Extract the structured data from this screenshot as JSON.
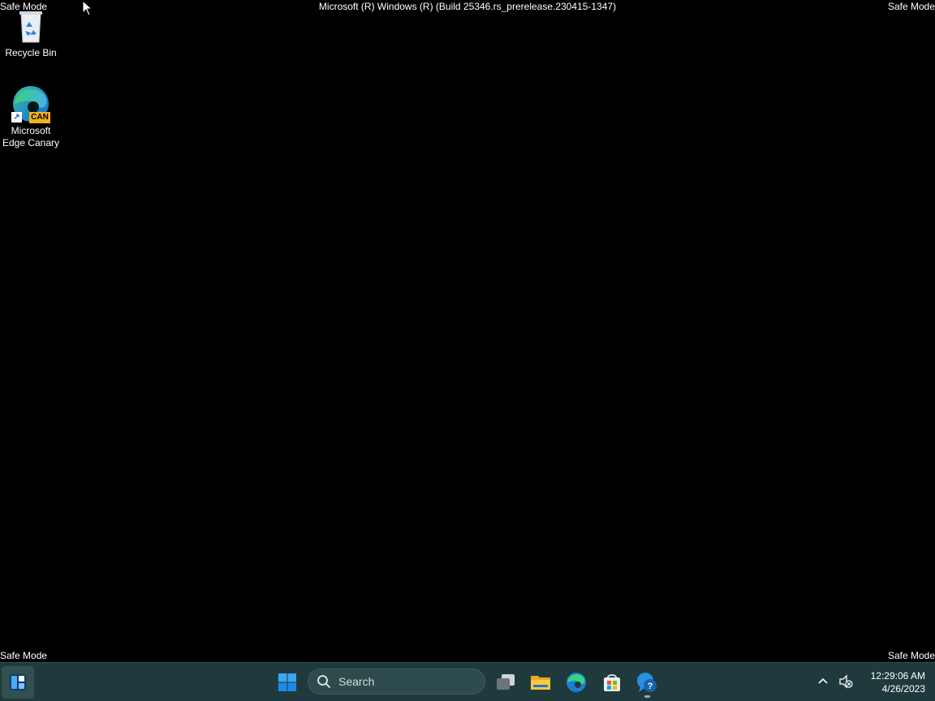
{
  "desktop": {
    "safe_mode_top_left": "Safe Mode",
    "safe_mode_top_right": "Safe Mode",
    "safe_mode_bottom_left": "Safe Mode",
    "safe_mode_bottom_right": "Safe Mode",
    "build_banner": "Microsoft (R) Windows (R) (Build 25346.rs_prerelease.230415-1347)",
    "icons": [
      {
        "label": "Recycle Bin",
        "icon": "recycle-bin-icon"
      },
      {
        "label_line1": "Microsoft",
        "label_line2": "Edge Canary",
        "badge": "CAN",
        "icon": "edge-canary-icon"
      }
    ]
  },
  "taskbar": {
    "search_placeholder": "Search",
    "apps": [
      {
        "name": "widgets",
        "icon": "widgets-icon"
      },
      {
        "name": "start",
        "icon": "windows-start-icon"
      },
      {
        "name": "task-view",
        "icon": "task-view-icon"
      },
      {
        "name": "file-explorer",
        "icon": "folder-icon"
      },
      {
        "name": "edge",
        "icon": "edge-icon"
      },
      {
        "name": "microsoft-store",
        "icon": "store-icon"
      },
      {
        "name": "get-help",
        "icon": "help-icon"
      }
    ],
    "clock": {
      "time": "12:29:06 AM",
      "date": "4/26/2023"
    }
  },
  "colors": {
    "desktop_background": "#000000",
    "taskbar_background": "#1f3a3d",
    "accent": "#0078d4"
  }
}
